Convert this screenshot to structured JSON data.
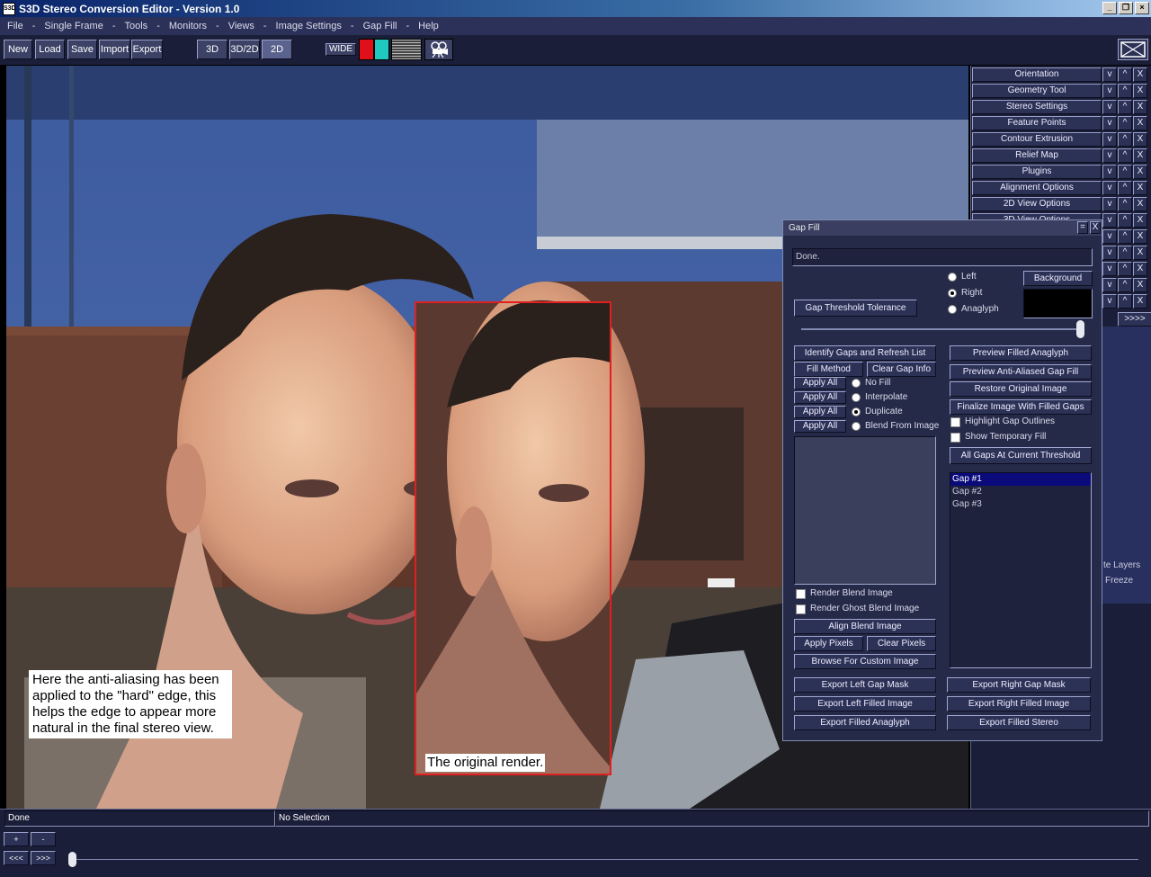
{
  "window": {
    "title": "S3D Stereo Conversion Editor - Version 1.0",
    "icon_text": "S3D"
  },
  "menu": [
    "File",
    "-",
    "Single Frame",
    "-",
    "Tools",
    "-",
    "Monitors",
    "-",
    "Views",
    "-",
    "Image Settings",
    "-",
    "Gap Fill",
    "-",
    "Help"
  ],
  "toolbar": {
    "new": "New",
    "load": "Load",
    "save": "Save",
    "import": "Import",
    "export": "Export",
    "mode_3d": "3D",
    "mode_3d2d": "3D/2D",
    "mode_2d": "2D",
    "wide": "WIDE",
    "color_left": "#e0101a",
    "color_right": "#20c8c0"
  },
  "callouts": {
    "left": "Here the anti-aliasing has been applied to the \"hard\" edge, this helps the edge to appear more natural in the final stereo view.",
    "center": "The original render."
  },
  "right_panel": {
    "items": [
      "Orientation",
      "Geometry Tool",
      "Stereo Settings",
      "Feature Points",
      "Contour Extrusion",
      "Relief Map",
      "Plugins",
      "Alignment Options",
      "2D View Options",
      "3D View Options"
    ],
    "btn_down": "v",
    "btn_up": "^",
    "btn_close": "X",
    "more": ">>>>",
    "layers_label": "te Layers",
    "freeze_label": "Freeze"
  },
  "gap_fill": {
    "title": "Gap Fill",
    "title_min": "=",
    "title_close": "X",
    "status": "Done.",
    "view_options": [
      "Left",
      "Right",
      "Anaglyph"
    ],
    "selected_view": "Right",
    "background_label": "Background",
    "background_color": "#000000",
    "threshold_label": "Gap Threshold Tolerance",
    "identify_btn": "Identify Gaps and Refresh List",
    "fill_method_btn": "Fill Method",
    "clear_gap_btn": "Clear Gap Info",
    "apply_all": "Apply All",
    "fill_methods": [
      "No Fill",
      "Interpolate",
      "Duplicate",
      "Blend From Image"
    ],
    "selected_fill": "Duplicate",
    "render_blend": "Render Blend Image",
    "render_ghost": "Render Ghost Blend Image",
    "align_blend": "Align Blend Image",
    "apply_pixels": "Apply Pixels",
    "clear_pixels": "Clear Pixels",
    "browse": "Browse For Custom Image",
    "preview_anaglyph": "Preview Filled Anaglyph",
    "preview_aa": "Preview Anti-Aliased Gap Fill",
    "restore": "Restore Original Image",
    "finalize": "Finalize Image With Filled Gaps",
    "highlight": "Highlight Gap Outlines",
    "show_temp": "Show Temporary Fill",
    "all_gaps": "All Gaps At Current Threshold",
    "gaps": [
      "Gap #1",
      "Gap #2",
      "Gap #3"
    ],
    "selected_gap": "Gap #1",
    "export_left_mask": "Export Left Gap Mask",
    "export_right_mask": "Export Right Gap Mask",
    "export_left_img": "Export Left Filled Image",
    "export_right_img": "Export Right Filled Image",
    "export_anaglyph": "Export Filled Anaglyph",
    "export_stereo": "Export Filled Stereo"
  },
  "status": {
    "left": "Done",
    "right": "No Selection"
  },
  "timeline": {
    "plus": "+",
    "minus": "-",
    "prev": "<<<",
    "next": ">>>"
  }
}
